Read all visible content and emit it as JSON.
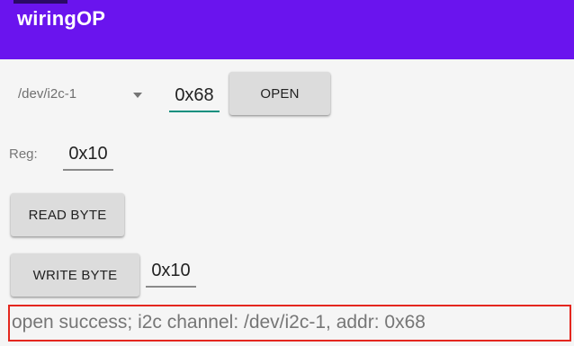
{
  "app_bar": {
    "title": "wiringOP"
  },
  "i2c": {
    "device_selected": "/dev/i2c-1",
    "address": "0x68",
    "open_label": "OPEN"
  },
  "register": {
    "label": "Reg:",
    "value": "0x10"
  },
  "actions": {
    "read_byte_label": "READ BYTE",
    "write_byte_label": "WRITE BYTE",
    "write_value": "0x10"
  },
  "status": {
    "text": "open success; i2c channel:  /dev/i2c-1, addr: 0x68"
  },
  "colors": {
    "app_bar": "#6a14ee",
    "focus_underline": "#0a8f7e",
    "highlight_border": "#e4271f"
  }
}
